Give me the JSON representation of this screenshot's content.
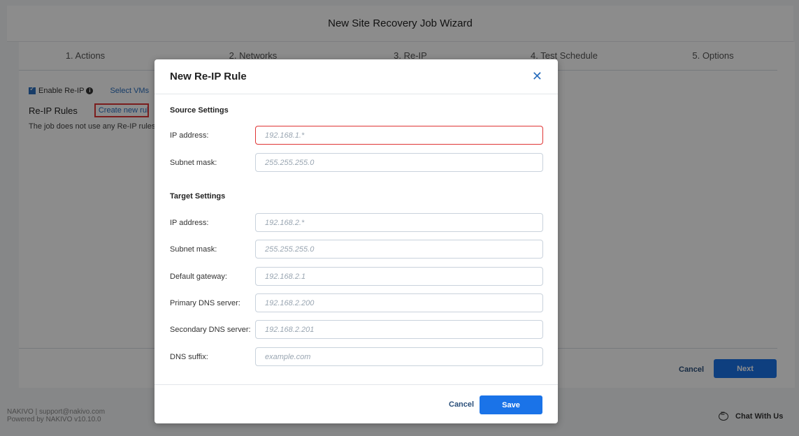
{
  "wizard": {
    "title": "New Site Recovery Job Wizard",
    "steps": [
      "1. Actions",
      "2. Networks",
      "3. Re-IP",
      "4. Test Schedule",
      "5. Options"
    ],
    "enable_reip_label": "Enable Re-IP",
    "select_vms_label": "Select VMs",
    "rules_title": "Re-IP Rules",
    "create_rule_label": "Create new rul",
    "no_rules_text": "The job does not use any Re-IP rules.",
    "cancel_label": "Cancel",
    "next_label": "Next"
  },
  "footer": {
    "line1": "NAKIVO | support@nakivo.com",
    "line2": "Powered by NAKIVO  v10.10.0",
    "chat_label": "Chat With Us"
  },
  "modal": {
    "title": "New Re-IP Rule",
    "close_icon": "close-icon",
    "source_title": "Source Settings",
    "target_title": "Target Settings",
    "source_fields": [
      {
        "label": "IP address:",
        "placeholder": "192.168.1.*"
      },
      {
        "label": "Subnet mask:",
        "placeholder": "255.255.255.0"
      }
    ],
    "target_fields": [
      {
        "label": "IP address:",
        "placeholder": "192.168.2.*"
      },
      {
        "label": "Subnet mask:",
        "placeholder": "255.255.255.0"
      },
      {
        "label": "Default gateway:",
        "placeholder": "192.168.2.1"
      },
      {
        "label": "Primary DNS server:",
        "placeholder": "192.168.2.200"
      },
      {
        "label": "Secondary DNS server:",
        "placeholder": "192.168.2.201"
      },
      {
        "label": "DNS suffix:",
        "placeholder": "example.com"
      }
    ],
    "cancel_label": "Cancel",
    "save_label": "Save"
  },
  "colors": {
    "accent": "#1a73e8",
    "error": "#e03535"
  }
}
